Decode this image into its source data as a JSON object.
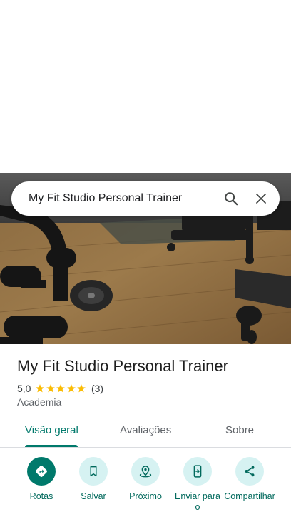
{
  "search": {
    "query": "My Fit Studio Personal Trainer"
  },
  "place": {
    "name": "My Fit Studio Personal Trainer",
    "rating": "5,0",
    "stars": 5,
    "review_count": "(3)",
    "category": "Academia"
  },
  "tabs": [
    {
      "label": "Visão geral"
    },
    {
      "label": "Avaliações"
    },
    {
      "label": "Sobre"
    }
  ],
  "actions": [
    {
      "label": "Rotas",
      "icon": "directions-icon"
    },
    {
      "label": "Salvar",
      "icon": "bookmark-icon"
    },
    {
      "label": "Próximo",
      "icon": "nearby-icon"
    },
    {
      "label": "Enviar para o",
      "icon": "send-to-phone-icon"
    },
    {
      "label": "Compartilhar",
      "icon": "share-icon"
    }
  ],
  "colors": {
    "accent": "#00796b",
    "action_bg": "#d6f2f2",
    "star": "#fbbc04"
  }
}
